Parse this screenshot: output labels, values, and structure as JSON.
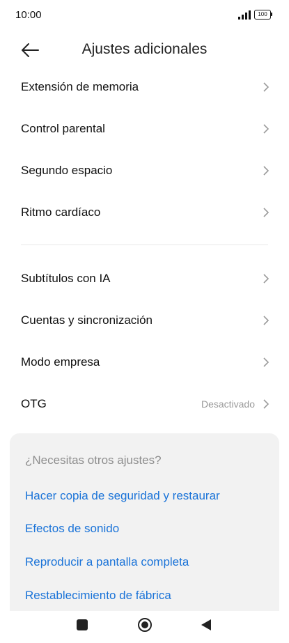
{
  "status_bar": {
    "time": "10:00",
    "battery": "100"
  },
  "header": {
    "title": "Ajustes adicionales"
  },
  "group1": [
    {
      "label": "Extensión de memoria"
    },
    {
      "label": "Control parental"
    },
    {
      "label": "Segundo espacio"
    },
    {
      "label": "Ritmo cardíaco"
    }
  ],
  "group2": [
    {
      "label": "Subtítulos con IA"
    },
    {
      "label": "Cuentas y sincronización"
    },
    {
      "label": "Modo empresa"
    },
    {
      "label": "OTG",
      "value": "Desactivado"
    }
  ],
  "suggestions": {
    "title": "¿Necesitas otros ajustes?",
    "links": [
      "Hacer copia de seguridad y restaurar",
      "Efectos de sonido",
      "Reproducir a pantalla completa",
      "Restablecimiento de fábrica"
    ]
  },
  "colors": {
    "link": "#1a73d8",
    "card_bg": "#f2f2f2",
    "secondary_text": "#9a9a9a"
  },
  "icons": {
    "back": "back-arrow-icon",
    "chevron": "chevron-right-icon",
    "nav_recents": "square-icon",
    "nav_home": "circle-icon",
    "nav_back": "triangle-back-icon"
  }
}
